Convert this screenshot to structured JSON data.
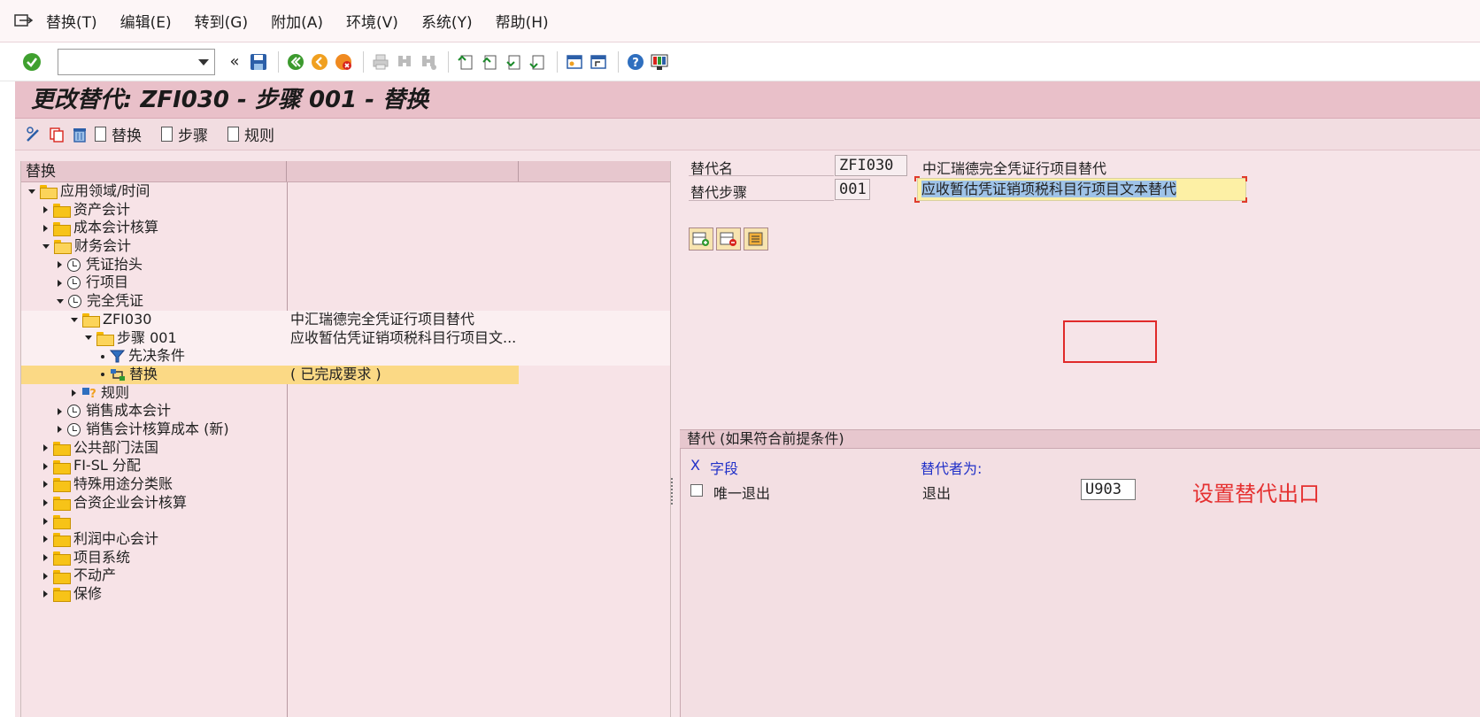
{
  "menu": [
    "替换(T)",
    "编辑(E)",
    "转到(G)",
    "附加(A)",
    "环境(V)",
    "系统(Y)",
    "帮助(H)"
  ],
  "toolbar": {
    "command_value": "",
    "back_glyph": "«"
  },
  "title": "更改替代: ZFI030 - 步骤 001 - 替换",
  "appbar": {
    "buttons": [
      "替换",
      "步骤",
      "规则"
    ]
  },
  "tree": {
    "header": "替换",
    "rows": [
      {
        "label": "应用领域/时间",
        "desc": ""
      },
      {
        "label": "资产会计",
        "desc": ""
      },
      {
        "label": "成本会计核算",
        "desc": ""
      },
      {
        "label": "财务会计",
        "desc": ""
      },
      {
        "label": "凭证抬头",
        "desc": ""
      },
      {
        "label": "行项目",
        "desc": ""
      },
      {
        "label": "完全凭证",
        "desc": ""
      },
      {
        "label": "ZFI030",
        "desc": "中汇瑞德完全凭证行项目替代"
      },
      {
        "label": "步骤 001",
        "desc": "应收暂估凭证销项税科目行项目文..."
      },
      {
        "label": "先决条件",
        "desc": ""
      },
      {
        "label": "替换",
        "desc": "( 已完成要求 )"
      },
      {
        "label": "规则",
        "desc": ""
      },
      {
        "label": "销售成本会计",
        "desc": ""
      },
      {
        "label": "销售会计核算成本 (新)",
        "desc": ""
      },
      {
        "label": "公共部门法国",
        "desc": ""
      },
      {
        "label": "FI-SL 分配",
        "desc": ""
      },
      {
        "label": "特殊用途分类账",
        "desc": ""
      },
      {
        "label": "合资企业会计核算",
        "desc": ""
      },
      {
        "label": "",
        "desc": ""
      },
      {
        "label": "利润中心会计",
        "desc": ""
      },
      {
        "label": "项目系统",
        "desc": ""
      },
      {
        "label": "不动产",
        "desc": ""
      },
      {
        "label": "保修",
        "desc": ""
      }
    ]
  },
  "detail": {
    "sub_name_label": "替代名",
    "sub_name_value": "ZFI030",
    "sub_name_text": "中汇瑞德完全凭证行项目替代",
    "step_label": "替代步骤",
    "step_value": "001",
    "step_text": "应收暂估凭证销项税科目行项目文本替代"
  },
  "group": {
    "header": "替代 (如果符合前提条件)",
    "col_x": "X",
    "col_field": "字段",
    "col_replaced": "替代者为:",
    "row_label": "唯一退出",
    "row_exit_label": "退出",
    "row_exit_value": "U903"
  },
  "annotation": "设置替代出口",
  "colors": {
    "title_bg": "#e9c0c9",
    "selected_row": "#fbd985",
    "annotation": "#e53030",
    "blue_text": "#2030c8"
  }
}
